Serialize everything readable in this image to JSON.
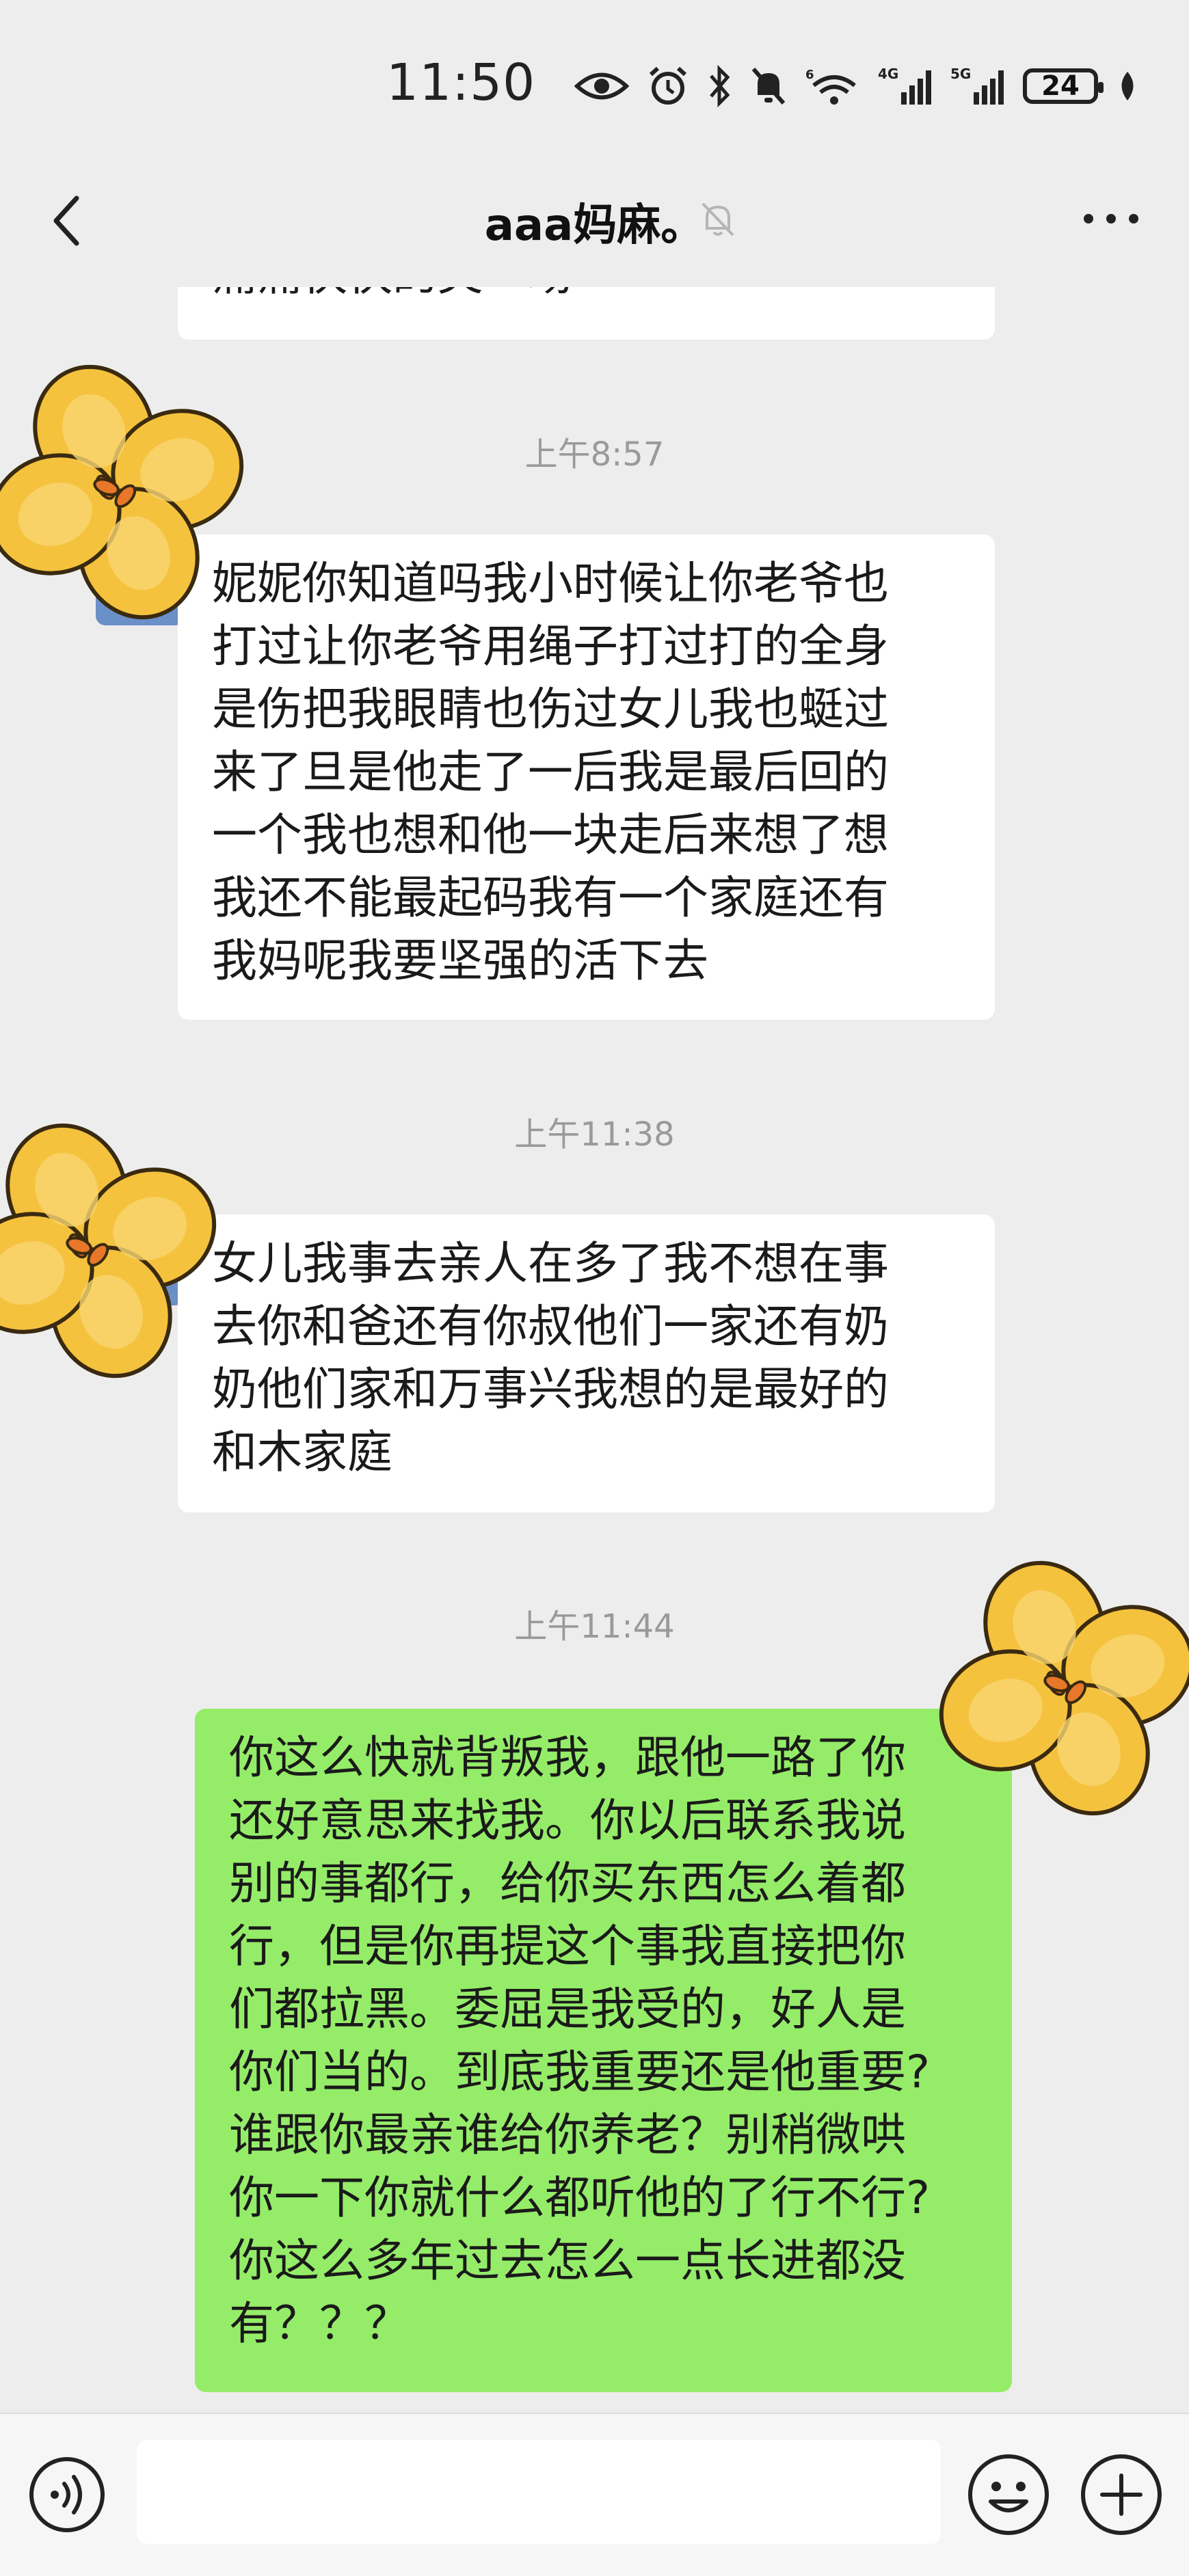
{
  "status_bar": {
    "time": "11:50",
    "battery": "24",
    "signal_labels": [
      "4G",
      "5G"
    ],
    "wifi_label": "6"
  },
  "header": {
    "title": "aaa妈麻。",
    "back_icon": "chevron-left-icon",
    "mute_icon": "bell-off-icon",
    "more_icon": "more-dots-icon"
  },
  "messages": [
    {
      "type": "partial",
      "text": "痛痛快快的哭一场"
    },
    {
      "type": "timestamp",
      "text": "上午8:57"
    },
    {
      "type": "incoming",
      "lines": [
        "妮妮你知道吗我小时候让你老爷也",
        "打过让你老爷用绳子打过打的全身",
        "是伤把我眼睛也伤过女儿我也蜓过",
        "来了旦是他走了一后我是最后回的",
        "一个我也想和他一块走后来想了想",
        "我还不能最起码我有一个家庭还有",
        "我妈呢我要坚强的活下去"
      ]
    },
    {
      "type": "timestamp",
      "text": "上午11:38"
    },
    {
      "type": "incoming",
      "lines": [
        "女儿我事去亲人在多了我不想在事",
        "去你和爸还有你叔他们一家还有奶",
        "奶他们家和万事兴我想的是最好的",
        "和木家庭"
      ]
    },
    {
      "type": "timestamp",
      "text": "上午11:44"
    },
    {
      "type": "outgoing",
      "lines": [
        "你这么快就背叛我，跟他一路了你",
        "还好意思来找我。你以后联系我说",
        "别的事都行，给你买东西怎么着都",
        "行，但是你再提这个事我直接把你",
        "们都拉黑。委屈是我受的，好人是",
        "你们当的。到底我重要还是他重要?",
        "谁跟你最亲谁给你养老？别稍微哄",
        "你一下你就什么都听他的了行不行?",
        "你这么多年过去怎么一点长进都没",
        "有？？？"
      ]
    }
  ],
  "input_bar": {
    "voice_icon": "voice-icon",
    "emoji_icon": "emoji-icon",
    "plus_icon": "plus-icon",
    "placeholder": ""
  },
  "colors": {
    "background": "#ededed",
    "incoming_bubble": "#ffffff",
    "outgoing_bubble": "#95ec69",
    "flower_petal": "#f5c23e",
    "flower_center": "#e8772a"
  }
}
